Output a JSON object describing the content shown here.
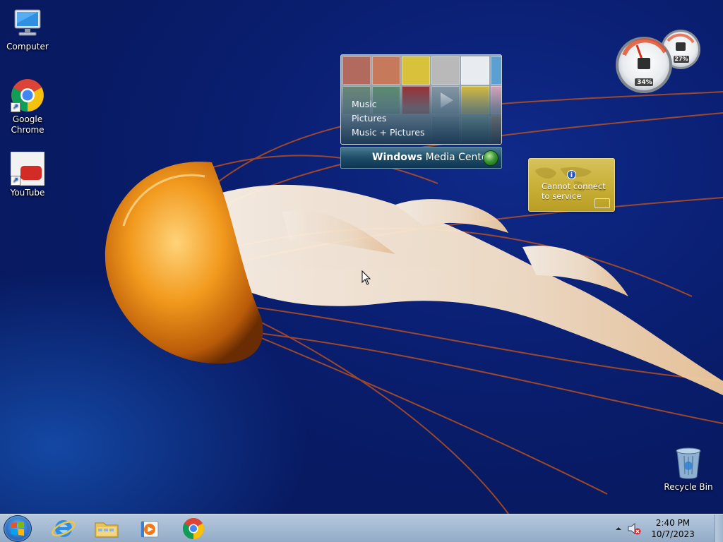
{
  "desktop": {
    "icons": [
      {
        "label": "Computer",
        "icon": "computer-icon"
      },
      {
        "label": "Google\nChrome",
        "icon": "chrome-icon"
      },
      {
        "label": "YouTube",
        "icon": "youtube-icon"
      },
      {
        "label": "Recycle Bin",
        "icon": "recycle-bin-icon"
      }
    ]
  },
  "gadgets": {
    "media_center": {
      "menu": [
        "Music",
        "Pictures",
        "Music + Pictures"
      ],
      "brand_bold": "Windows",
      "brand_rest": " Media Center"
    },
    "news": {
      "message": "Cannot connect to service"
    },
    "meter": {
      "cpu_label": "34%",
      "memory_label": "27%"
    }
  },
  "taskbar": {
    "apps": [
      "internet-explorer-icon",
      "file-explorer-icon",
      "media-player-icon",
      "chrome-icon"
    ],
    "clock": {
      "time": "2:40 PM",
      "date": "10/7/2023"
    }
  },
  "colors": {
    "desktop_blue": "#0a1f72",
    "taskbar": "#a6bcd4",
    "news_gold": "#c6ad34"
  }
}
